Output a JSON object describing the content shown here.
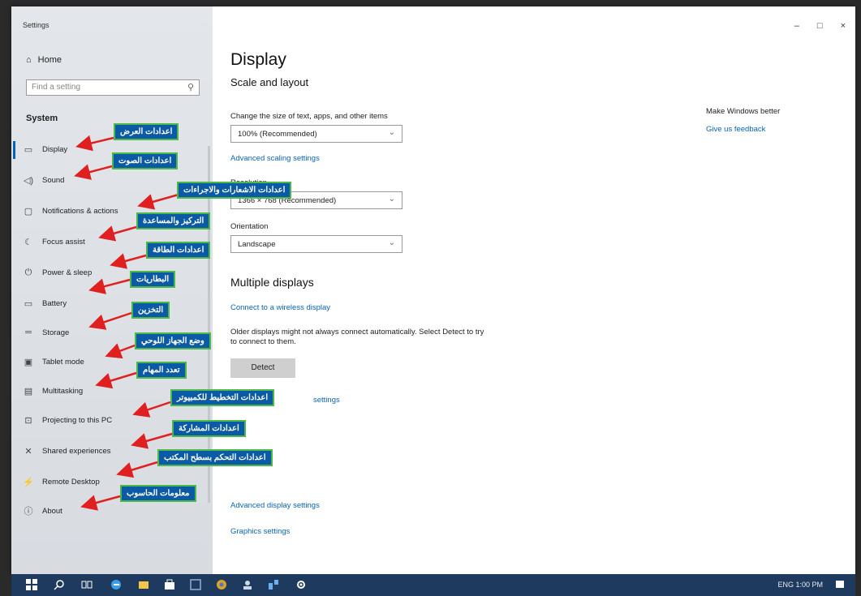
{
  "window": {
    "title": "Settings",
    "controls": [
      "–",
      "□",
      "×"
    ]
  },
  "sidebar": {
    "home": {
      "label": "Home",
      "icon": "home-icon"
    },
    "search_placeholder": "Find a setting",
    "group": "System",
    "items": [
      {
        "label": "Display",
        "icon": "monitor-icon",
        "glyph": "▭"
      },
      {
        "label": "Sound",
        "icon": "speaker-icon",
        "glyph": "◁)"
      },
      {
        "label": "Notifications & actions",
        "icon": "notification-icon",
        "glyph": "▢"
      },
      {
        "label": "Focus assist",
        "icon": "moon-icon",
        "glyph": "☾"
      },
      {
        "label": "Power & sleep",
        "icon": "power-icon",
        "glyph": "⏻"
      },
      {
        "label": "Battery",
        "icon": "battery-icon",
        "glyph": "▭"
      },
      {
        "label": "Storage",
        "icon": "storage-icon",
        "glyph": "═"
      },
      {
        "label": "Tablet mode",
        "icon": "tablet-icon",
        "glyph": "▣"
      },
      {
        "label": "Multitasking",
        "icon": "multitasking-icon",
        "glyph": "▤"
      },
      {
        "label": "Projecting to this PC",
        "icon": "projector-icon",
        "glyph": "⊡"
      },
      {
        "label": "Shared experiences",
        "icon": "shared-icon",
        "glyph": "✕"
      },
      {
        "label": "Remote Desktop",
        "icon": "remote-icon",
        "glyph": "⚡"
      },
      {
        "label": "About",
        "icon": "info-icon",
        "glyph": "ⓘ"
      }
    ]
  },
  "main": {
    "title": "Display",
    "section": "Scale and layout",
    "scale_label": "Change the size of text, apps, and other items",
    "scale_value": "100% (Recommended)",
    "advanced_scaling": "Advanced scaling settings",
    "resolution_label": "Resolution",
    "resolution_value": "1366 × 768 (Recommended)",
    "orientation_label": "Orientation",
    "orientation_value": "Landscape",
    "multiple": "Multiple displays",
    "wireless": "Connect to a wireless display",
    "older_text": "Older displays might not always connect automatically. Select Detect to try to connect to them.",
    "detect": "Detect",
    "graphics_link": "Graphics settings",
    "advanced_display": "Advanced display settings",
    "partial_link": "settings"
  },
  "aside": {
    "heading": "Make Windows better",
    "link": "Give us feedback"
  },
  "annotations": [
    "اعدادات العرض",
    "اعدادات الصوت",
    "اعدادات الاشعارات والاجراءات",
    "التركيز والمساعدة",
    "اعدادات الطاقة",
    "البطاريات",
    "التخزين",
    "وضع الجهاز اللوحي",
    "تعدد المهام",
    "اعدادات التخطيط للكمبيوتر",
    "اعدادات المشاركة",
    "اعدادات التحكم بسطح المكتب",
    "معلومات الحاسوب"
  ],
  "colors": {
    "accent": "#0067b8",
    "annotation_bg": "#0b5aa5",
    "annotation_border": "#4cb848",
    "arrow": "#e02020",
    "taskbar": "#1e3a5e"
  },
  "taskbar": {
    "tray": "ENG 1:00 PM"
  }
}
